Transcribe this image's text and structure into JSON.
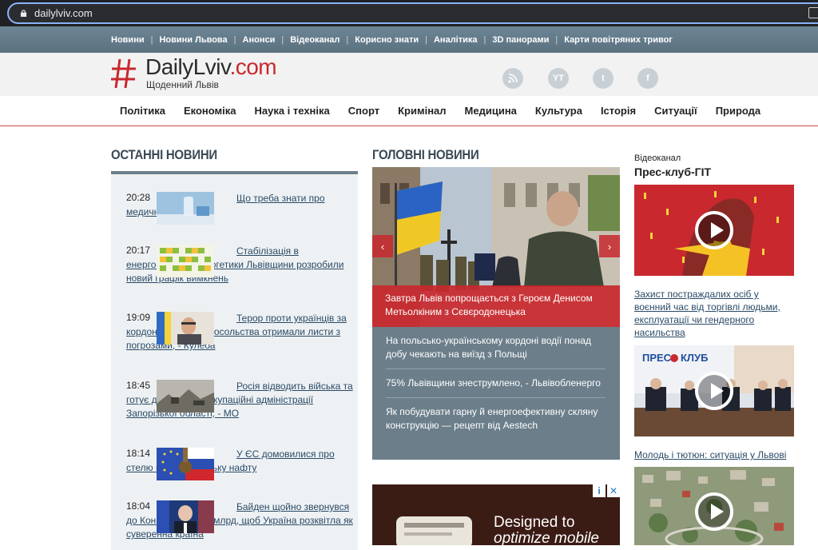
{
  "browser": {
    "url": "dailylviv.com"
  },
  "top_nav": [
    "Новини",
    "Новини Львова",
    "Анонси",
    "Відеоканал",
    "Корисно знати",
    "Аналітика",
    "3D панорами",
    "Карти повітряних тривог"
  ],
  "header": {
    "logo_name": "DailyLviv",
    "logo_tld": ".com",
    "logo_tagline": "Щоденний Львів",
    "social": [
      "rss-icon",
      "youtube-icon",
      "twitter-icon",
      "facebook-icon"
    ],
    "social_labels": {
      "youtube": "YT",
      "twitter": "t",
      "facebook": "f"
    }
  },
  "categories": [
    "Політика",
    "Економіка",
    "Наука і техніка",
    "Спорт",
    "Кримінал",
    "Медицина",
    "Культура",
    "Історія",
    "Ситуації",
    "Природа"
  ],
  "latest": {
    "title": "ОСТАННІ НОВИНИ",
    "items": [
      {
        "time": "20:28",
        "headline": "Що треба знати про медичний спирт?"
      },
      {
        "time": "20:17",
        "headline": "Стабілізація в енергосистемі: енергетики Львівщини розробили новий графік вимкнень"
      },
      {
        "time": "19:09",
        "headline": "Терор проти українців за кордоном: ще два посольства отримали листи з погрозами, - Кулеба"
      },
      {
        "time": "18:45",
        "headline": "Росія відводить війська та готує до евакуації окупаційні адміністрації Запорізької області, - МО"
      },
      {
        "time": "18:14",
        "headline": "У ЄС домовилися про стелю цін на російську нафту"
      },
      {
        "time": "18:04",
        "headline": "Байден щойно звернувся до Конгресу за $37 млрд, щоб Україна розквітла як суверенна країна"
      }
    ]
  },
  "main": {
    "title": "ГОЛОВНІ НОВИНИ",
    "hero_caption": "Завтра Львів попрощається з Героєм Денисом Метьолкіним з Сєвєродонецька",
    "prev": "‹",
    "next": "›",
    "items": [
      "На польсько-українському кордоні водії понад добу чекають на виїзд з Польщі",
      "75% Львівщини знеструмлено, - Львівобленерго",
      "Як побудувати гарну й енергоефективну скляну конструкцію — рецепт від Aestech"
    ],
    "ad": {
      "text_line1": "Designed to",
      "text_line2": "optimize mobile",
      "close": "✕",
      "info": "i"
    }
  },
  "video": {
    "kicker": "Відеоканал",
    "title": "Прес-клуб-ГІТ",
    "links": [
      "Захист постраждалих осіб у воєнний час від торгівлі людьми, експлуатації чи гендерного насильства",
      "Молодь і тютюн: ситуація у Львові"
    ]
  },
  "colors": {
    "accent": "#c8282e",
    "nav_bg": "#647b89",
    "link": "#2a4a66"
  }
}
